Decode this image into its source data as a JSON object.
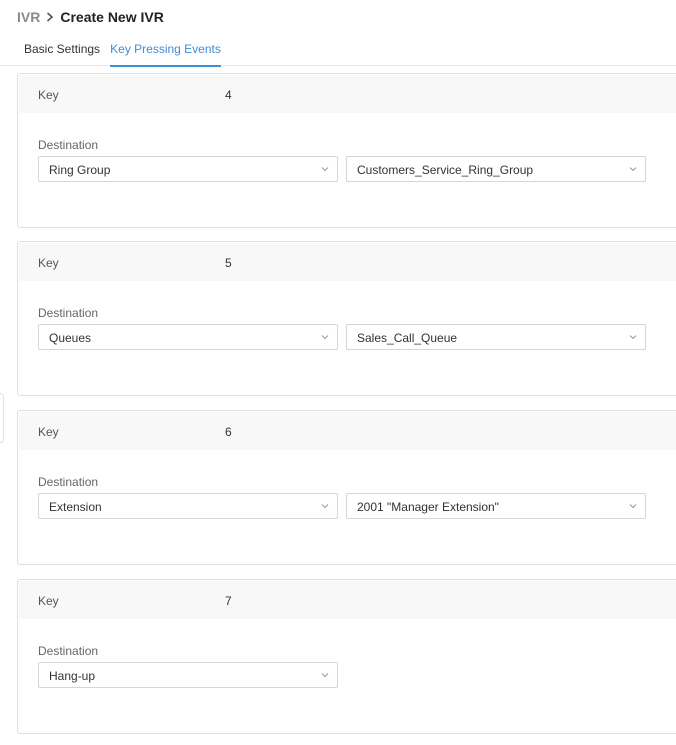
{
  "breadcrumb": {
    "root": "IVR",
    "current": "Create New IVR"
  },
  "tabs": [
    {
      "label": "Basic Settings",
      "active": false
    },
    {
      "label": "Key Pressing Events",
      "active": true
    }
  ],
  "accent_color": "#3d8fd6",
  "icons": {
    "separator": "chevron-right-icon",
    "dropdown": "chevron-down-icon"
  },
  "events": {
    "labels": {
      "key": "Key",
      "destination": "Destination"
    },
    "items": [
      {
        "key": "4",
        "destination_type": "Ring Group",
        "destination_target": "Customers_Service_Ring_Group"
      },
      {
        "key": "5",
        "destination_type": "Queues",
        "destination_target": "Sales_Call_Queue"
      },
      {
        "key": "6",
        "destination_type": "Extension",
        "destination_target": "2001 \"Manager Extension\""
      },
      {
        "key": "7",
        "destination_type": "Hang-up",
        "destination_target": null
      }
    ]
  }
}
